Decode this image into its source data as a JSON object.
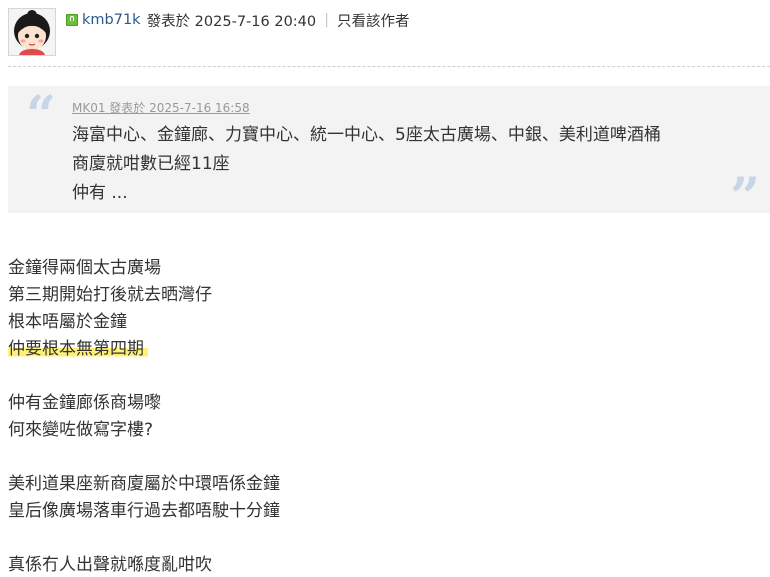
{
  "post": {
    "author": "kmb71k",
    "posted_label": "發表於 2025-7-16 20:40",
    "separator": "|",
    "only_author_label": "只看該作者"
  },
  "quote": {
    "author_line": "MK01 發表於 2025-7-16 16:58",
    "lines": [
      "海富中心、金鐘廊、力寶中心、統一中心、5座太古廣場、中銀、美利道啤酒桶",
      "商廈就咁數已經11座",
      "仲有 ..."
    ]
  },
  "body": {
    "lines": [
      "金鐘得兩個太古廣場",
      "第三期開始打後就去晒灣仔",
      "根本唔屬於金鐘",
      "仲要根本無第四期",
      "仲有金鐘廊係商場嚟",
      "何來變咗做寫字樓?",
      "美利道果座新商廈屬於中環唔係金鐘",
      "皇后像廣場落車行過去都唔駛十分鐘",
      "真係冇人出聲就喺度亂咁吹"
    ],
    "highlight_color": "#fff176"
  },
  "icons": {
    "avatar": "cartoon-girl-avatar",
    "online": "online-user-icon",
    "quote_open": "open-quote-icon",
    "quote_close": "close-quote-icon"
  },
  "colors": {
    "link": "#2b5a8c",
    "quote_bg": "#f3f3f3",
    "quote_mark": "#c7d6e6"
  }
}
